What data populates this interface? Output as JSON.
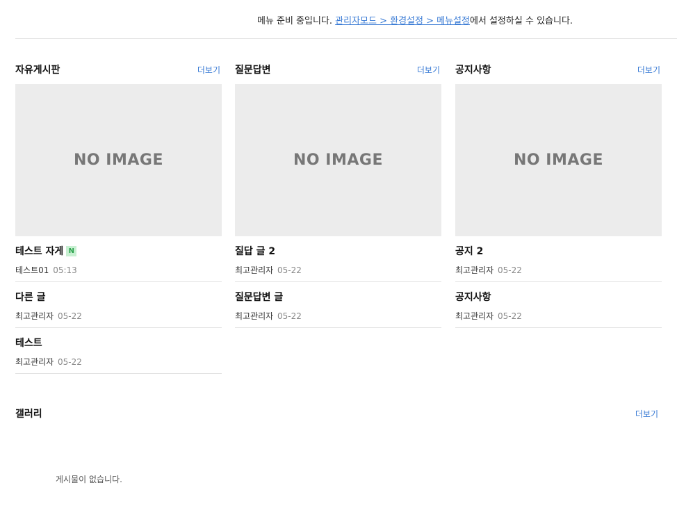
{
  "notice": {
    "prefix": "메뉴 준비 중입니다. ",
    "link": "관리자모드 > 환경설정 > 메뉴설정",
    "suffix": "에서 설정하실 수 있습니다."
  },
  "boards": [
    {
      "title": "자유게시판",
      "more": "더보기",
      "thumb": "NO IMAGE",
      "posts": [
        {
          "title": "테스트 자게",
          "badge": "N",
          "author": "테스트01",
          "date": "05:13"
        },
        {
          "title": "다른 글",
          "author": "최고관리자",
          "date": "05-22"
        },
        {
          "title": "테스트",
          "author": "최고관리자",
          "date": "05-22"
        }
      ]
    },
    {
      "title": "질문답변",
      "more": "더보기",
      "thumb": "NO IMAGE",
      "posts": [
        {
          "title": "질답 글 2",
          "author": "최고관리자",
          "date": "05-22"
        },
        {
          "title": "질문답변 글",
          "author": "최고관리자",
          "date": "05-22"
        }
      ]
    },
    {
      "title": "공지사항",
      "more": "더보기",
      "thumb": "NO IMAGE",
      "posts": [
        {
          "title": "공지 2",
          "author": "최고관리자",
          "date": "05-22"
        },
        {
          "title": "공지사항",
          "author": "최고관리자",
          "date": "05-22"
        }
      ]
    }
  ],
  "gallery": {
    "title": "갤러리",
    "more": "더보기",
    "empty": "게시물이 없습니다."
  }
}
